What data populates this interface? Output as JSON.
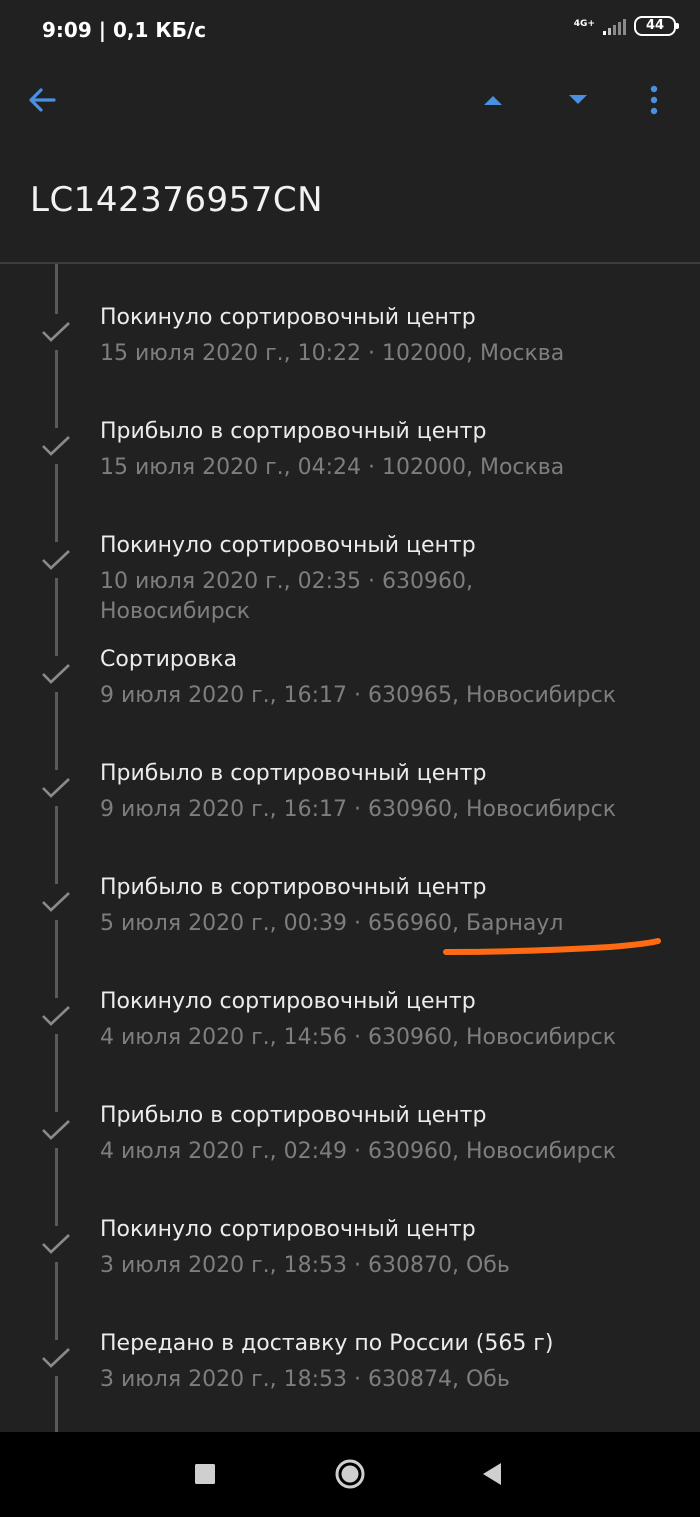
{
  "status_bar": {
    "time_speed": "9:09 | 0,1 КБ/с",
    "network": "4G+",
    "battery": "44"
  },
  "toolbar": {
    "back_icon": "arrow-left-icon",
    "prev_icon": "triangle-up-icon",
    "next_icon": "triangle-down-icon",
    "more_icon": "more-vertical-icon",
    "accent_color": "#4a90e2"
  },
  "tracking_number": "LC142376957CN",
  "events": [
    {
      "status": "Покинуло сортировочный центр",
      "details": "15 июля 2020 г., 10:22 · 102000, Москва"
    },
    {
      "status": "Прибыло в сортировочный центр",
      "details": "15 июля 2020 г., 04:24 · 102000, Москва"
    },
    {
      "status": "Покинуло сортировочный центр",
      "details": "10 июля 2020 г., 02:35 · 630960, Новосибирск"
    },
    {
      "status": "Сортировка",
      "details": "9 июля 2020 г., 16:17 · 630965, Новосибирск"
    },
    {
      "status": "Прибыло в сортировочный центр",
      "details": "9 июля 2020 г., 16:17 · 630960, Новосибирск"
    },
    {
      "status": "Прибыло в сортировочный центр",
      "details": "5 июля 2020 г., 00:39 · 656960, Барнаул"
    },
    {
      "status": "Покинуло сортировочный центр",
      "details": "4 июля 2020 г., 14:56 · 630960, Новосибирск"
    },
    {
      "status": "Прибыло в сортировочный центр",
      "details": "4 июля 2020 г., 02:49 · 630960, Новосибирск"
    },
    {
      "status": "Покинуло сортировочный центр",
      "details": "3 июля 2020 г., 18:53 · 630870, Обь"
    },
    {
      "status": "Передано в доставку по России (565 г)",
      "details": "3 июля 2020 г., 18:53 · 630874, Обь"
    }
  ],
  "annotation_color": "#ff6a13",
  "nav_bar": {
    "recents_icon": "square-icon",
    "home_icon": "circle-home-icon",
    "back_icon": "triangle-back-icon"
  }
}
